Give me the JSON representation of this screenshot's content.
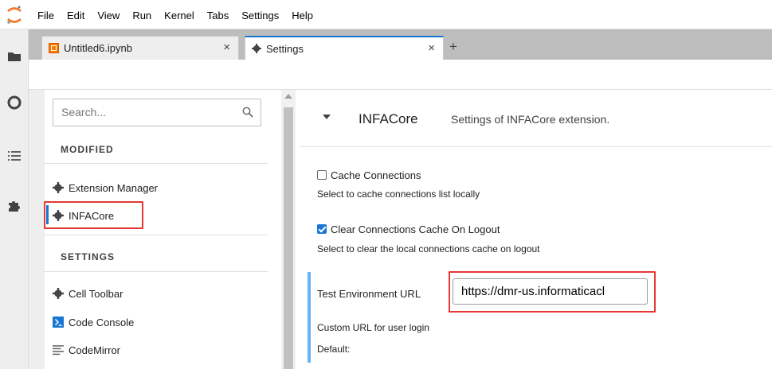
{
  "menubar": {
    "items": [
      "File",
      "Edit",
      "View",
      "Run",
      "Kernel",
      "Tabs",
      "Settings",
      "Help"
    ],
    "logo_icon": "jupyter-logo-icon"
  },
  "activity_bar": {
    "icons": [
      "folder-icon",
      "running-circle-icon",
      "list-icon",
      "puzzle-extension-icon"
    ]
  },
  "tabs": [
    {
      "label": "Untitled6.ipynb",
      "icon": "notebook-icon",
      "active": false,
      "close": "×"
    },
    {
      "label": "Settings",
      "icon": "gear-icon",
      "active": true,
      "close": "×"
    }
  ],
  "tab_add_label": "+",
  "settings_list": {
    "search_placeholder": "Search...",
    "sections": [
      {
        "title": "MODIFIED",
        "items": [
          {
            "label": "Extension Manager",
            "icon": "gear-icon"
          },
          {
            "label": "INFACore",
            "icon": "gear-icon",
            "selected": true
          }
        ]
      },
      {
        "title": "SETTINGS",
        "items": [
          {
            "label": "Cell Toolbar",
            "icon": "gear-icon"
          },
          {
            "label": "Code Console",
            "icon": "console-icon"
          },
          {
            "label": "CodeMirror",
            "icon": "lines-icon"
          }
        ]
      }
    ]
  },
  "editor": {
    "title": "INFACore",
    "description": "Settings of INFACore extension.",
    "fields": {
      "cache_connections": {
        "label": "Cache Connections",
        "checked": false,
        "description": "Select to cache connections list locally"
      },
      "clear_cache": {
        "label": "Clear Connections Cache On Logout",
        "checked": true,
        "description": "Select to clear the local connections cache on logout"
      },
      "test_env_url": {
        "label": "Test Environment URL",
        "value": "https://dmr-us.informaticacl"
      },
      "custom_url_desc": "Custom URL for user login",
      "default_label": "Default:"
    }
  },
  "colors": {
    "accent": "#1976d2",
    "highlight_box": "#e53935",
    "checked_box": "#1976d2",
    "url_block_bar": "#64b5f6"
  }
}
